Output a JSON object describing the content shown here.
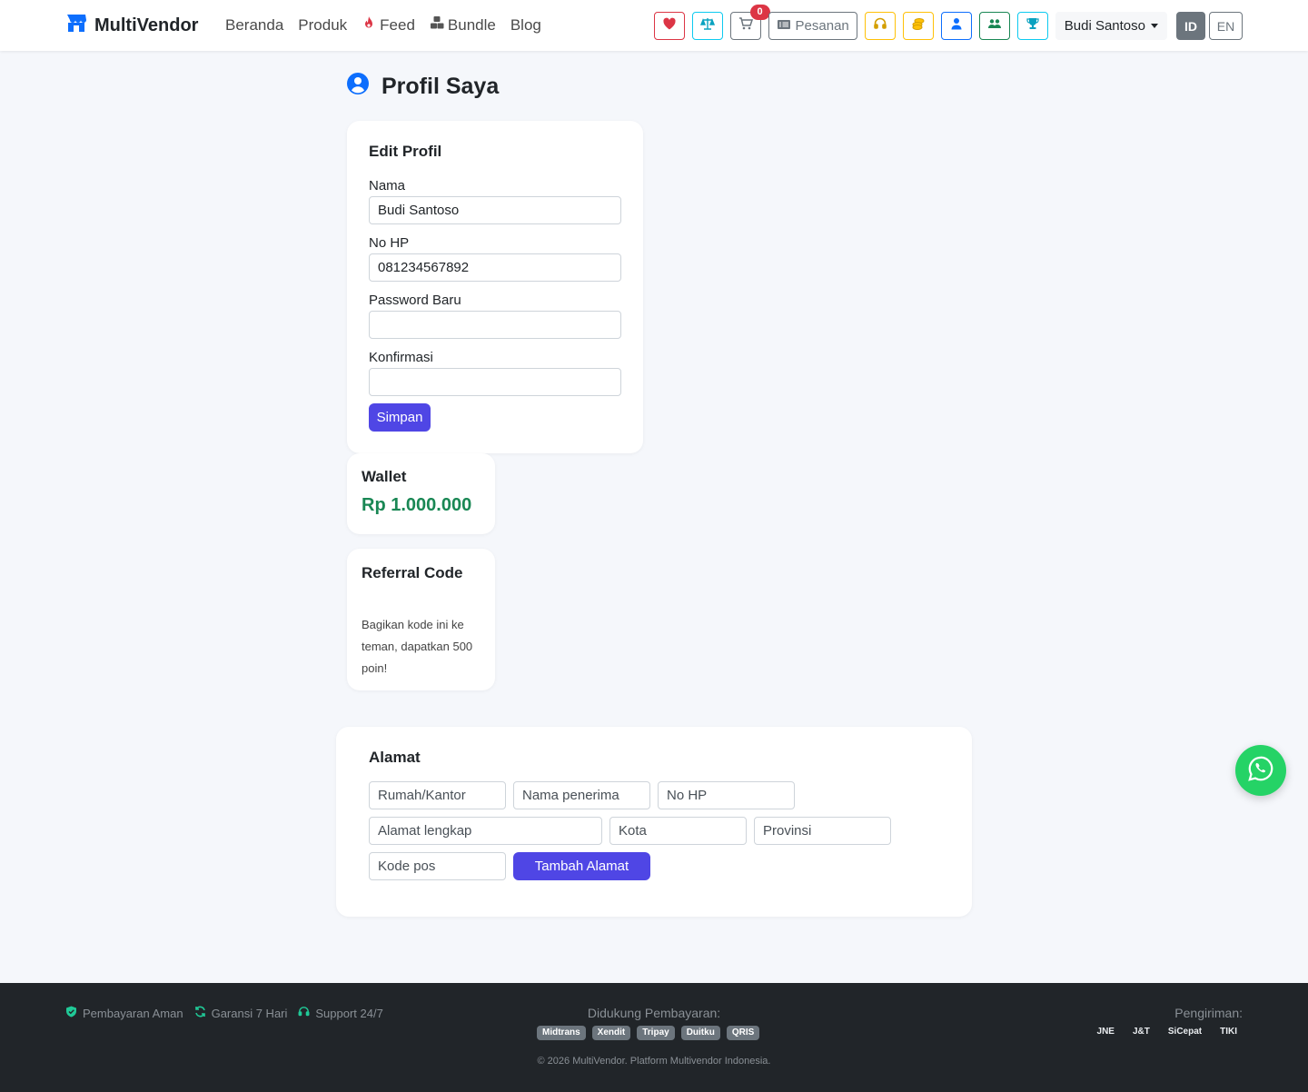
{
  "colors": {
    "primary": "#4f46e5",
    "brand_blue": "#0d6efd",
    "wallet_green": "#198754",
    "whatsapp": "#25d366",
    "footer_bg": "#212529",
    "page_bg": "#f5f7fb"
  },
  "navbar": {
    "brand": "MultiVendor",
    "brand_icon": "store-icon",
    "links": [
      {
        "label": "Beranda",
        "icon": null
      },
      {
        "label": "Produk",
        "icon": null
      },
      {
        "label": "Feed",
        "icon": "fire-icon"
      },
      {
        "label": "Bundle",
        "icon": "boxes-icon"
      },
      {
        "label": "Blog",
        "icon": null
      }
    ],
    "icon_buttons": [
      {
        "name": "wishlist",
        "icon": "heart-icon"
      },
      {
        "name": "compare",
        "icon": "scale-icon"
      },
      {
        "name": "cart",
        "icon": "cart-icon",
        "badge": "0"
      },
      {
        "name": "orders",
        "icon": "list-icon",
        "label": "Pesanan"
      },
      {
        "name": "support",
        "icon": "headset-icon"
      },
      {
        "name": "points",
        "icon": "coins-icon"
      },
      {
        "name": "profile",
        "icon": "user-icon"
      },
      {
        "name": "referral",
        "icon": "users-icon"
      },
      {
        "name": "rewards",
        "icon": "trophy-icon"
      }
    ],
    "user_name": "Budi Santoso",
    "lang_active": "ID",
    "lang_other": "EN"
  },
  "page": {
    "title": "Profil Saya",
    "title_icon": "user-circle-icon"
  },
  "edit_profile": {
    "title": "Edit Profil",
    "name_label": "Nama",
    "name_value": "Budi Santoso",
    "phone_label": "No HP",
    "phone_value": "081234567892",
    "password_label": "Password Baru",
    "password_value": "",
    "confirm_label": "Konfirmasi",
    "confirm_value": "",
    "save_label": "Simpan"
  },
  "wallet": {
    "title": "Wallet",
    "amount": "Rp 1.000.000"
  },
  "referral": {
    "title": "Referral Code",
    "code": "",
    "description": "Bagikan kode ini ke teman, dapatkan 500 poin!"
  },
  "address": {
    "title": "Alamat",
    "label_placeholder": "Rumah/Kantor",
    "recipient_placeholder": "Nama penerima",
    "phone_placeholder": "No HP",
    "full_address_placeholder": "Alamat lengkap",
    "city_placeholder": "Kota",
    "province_placeholder": "Provinsi",
    "postal_placeholder": "Kode pos",
    "add_label": "Tambah Alamat"
  },
  "footer": {
    "trust": [
      {
        "label": "Pembayaran Aman",
        "icon": "shield-icon"
      },
      {
        "label": "Garansi 7 Hari",
        "icon": "refresh-icon"
      },
      {
        "label": "Support 24/7",
        "icon": "headset-icon"
      }
    ],
    "payment_title": "Didukung Pembayaran:",
    "payments": [
      "Midtrans",
      "Xendit",
      "Tripay",
      "Duitku",
      "QRIS"
    ],
    "shipping_title": "Pengiriman:",
    "shipping": [
      "JNE",
      "J&T",
      "SiCepat",
      "TIKI"
    ],
    "copyright": "© 2026 MultiVendor. Platform Multivendor Indonesia."
  }
}
